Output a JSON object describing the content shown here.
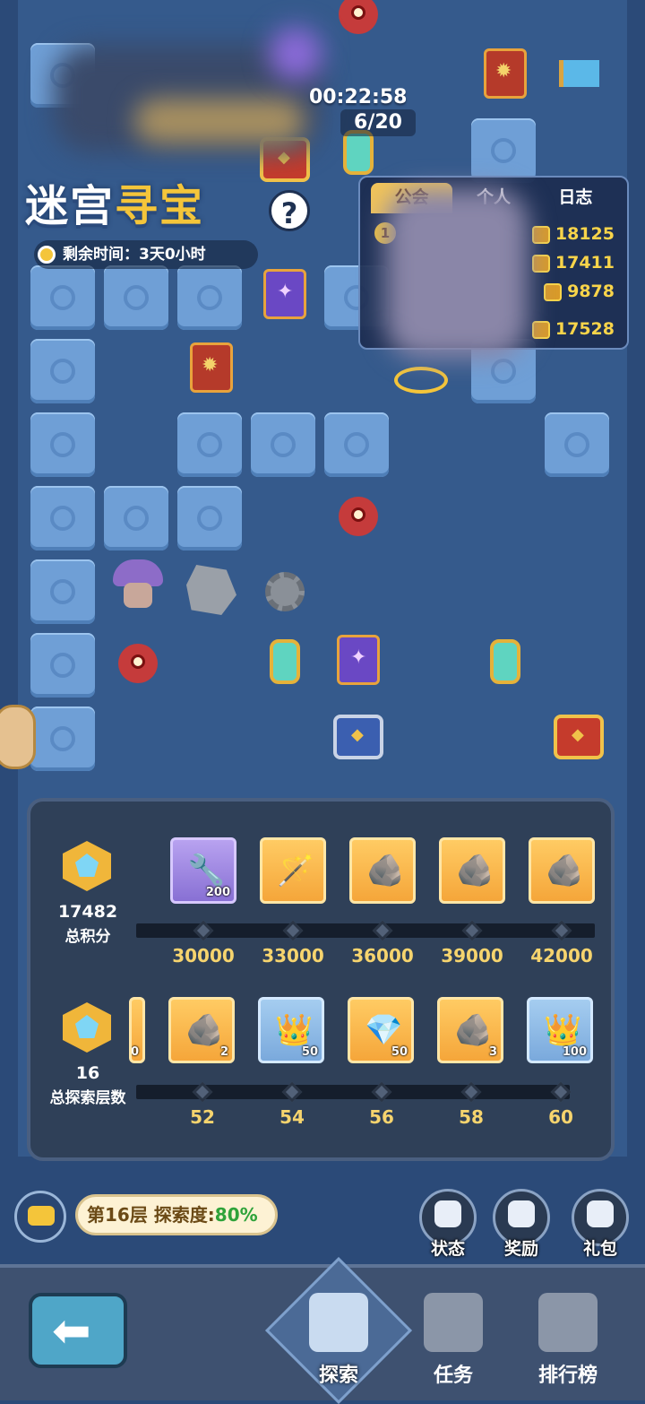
{
  "header": {
    "timer": "00:22:58",
    "progress": "6/20",
    "title_part1": "迷宫",
    "title_part2": "寻宝",
    "help_icon": "?",
    "remaining_label": "剩余时间：3天0小时"
  },
  "ranking": {
    "tabs": [
      "公会",
      "个人",
      "日志"
    ],
    "active_tab": 0,
    "rows": [
      {
        "rank": "1",
        "score": "18125"
      },
      {
        "rank": "",
        "score": "17411"
      },
      {
        "rank": "",
        "score": "9878"
      },
      {
        "rank": "",
        "score": "17528"
      }
    ]
  },
  "rewards": {
    "points": {
      "value": "17482",
      "label": "总积分",
      "items": [
        {
          "icon": "chisel-icon",
          "count": "200",
          "style": "purple"
        },
        {
          "icon": "wand-icon",
          "count": "",
          "style": "gold"
        },
        {
          "icon": "gold-ore-icon",
          "count": "",
          "style": "gold"
        },
        {
          "icon": "gold-ore-icon",
          "count": "",
          "style": "gold"
        },
        {
          "icon": "gold-ore-icon",
          "count": "",
          "style": "gold"
        }
      ],
      "thresholds": [
        "30000",
        "33000",
        "36000",
        "39000",
        "42000"
      ]
    },
    "floors": {
      "value": "16",
      "label": "总探索层数",
      "partial_count": "0",
      "items": [
        {
          "icon": "gold-ore-icon",
          "count": "2",
          "style": "gold"
        },
        {
          "icon": "crown-badge-icon",
          "count": "50",
          "style": "blue"
        },
        {
          "icon": "diamond-icon",
          "count": "50",
          "style": "gold"
        },
        {
          "icon": "gold-ore-icon",
          "count": "3",
          "style": "gold"
        },
        {
          "icon": "crown-badge-icon",
          "count": "100",
          "style": "blue"
        }
      ],
      "thresholds": [
        "52",
        "54",
        "56",
        "58",
        "60"
      ]
    }
  },
  "status": {
    "floor_text": "第16层 探索度:",
    "explore_pct": "80%"
  },
  "side_buttons": [
    {
      "label": "状态",
      "icon": "ghost-status-icon"
    },
    {
      "label": "奖励",
      "icon": "pickaxe-reward-icon"
    },
    {
      "label": "礼包",
      "icon": "gift-icon"
    }
  ],
  "bottom_nav": [
    {
      "label": "探索",
      "icon": "explore-shrine-icon",
      "active": true
    },
    {
      "label": "任务",
      "icon": "quest-book-icon",
      "active": false
    },
    {
      "label": "排行榜",
      "icon": "trophy-icon",
      "active": false
    }
  ]
}
